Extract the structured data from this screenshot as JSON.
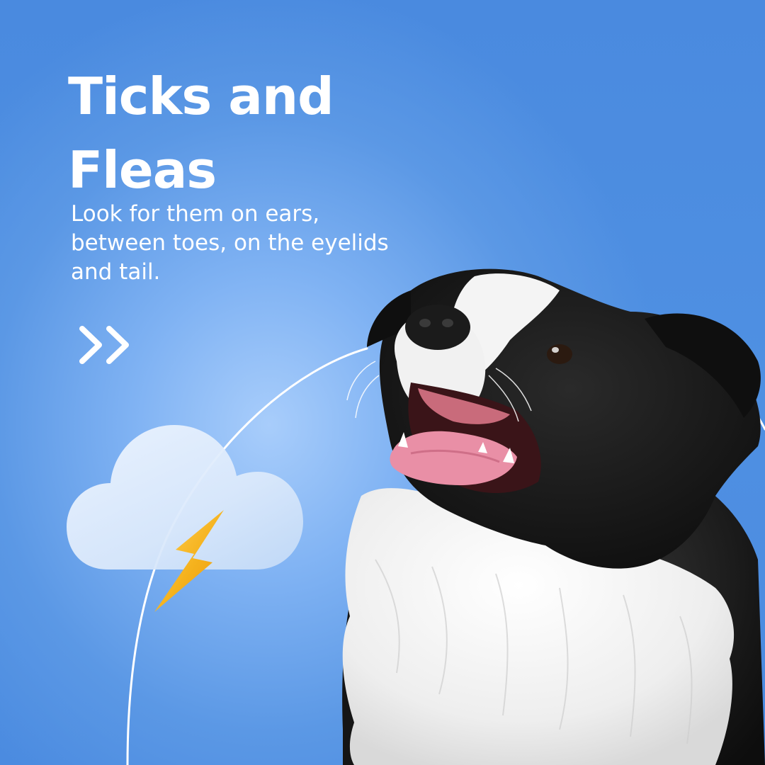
{
  "title": "Ticks and Fleas",
  "subtitle": "Look for them on ears, between toes, on the eyelids and tail.",
  "icons": {
    "next": "double-chevron-right-icon",
    "weather": "cloud-icon",
    "bolt": "lightning-bolt-icon",
    "photo": "border-collie-dog"
  },
  "colors": {
    "background": "#4a8de0",
    "background_glow": "#a8cdfb",
    "text": "#ffffff",
    "bolt": "#f4b21c",
    "dog_black": "#141414",
    "dog_white": "#f5f5f5",
    "tongue": "#e98fa6"
  }
}
